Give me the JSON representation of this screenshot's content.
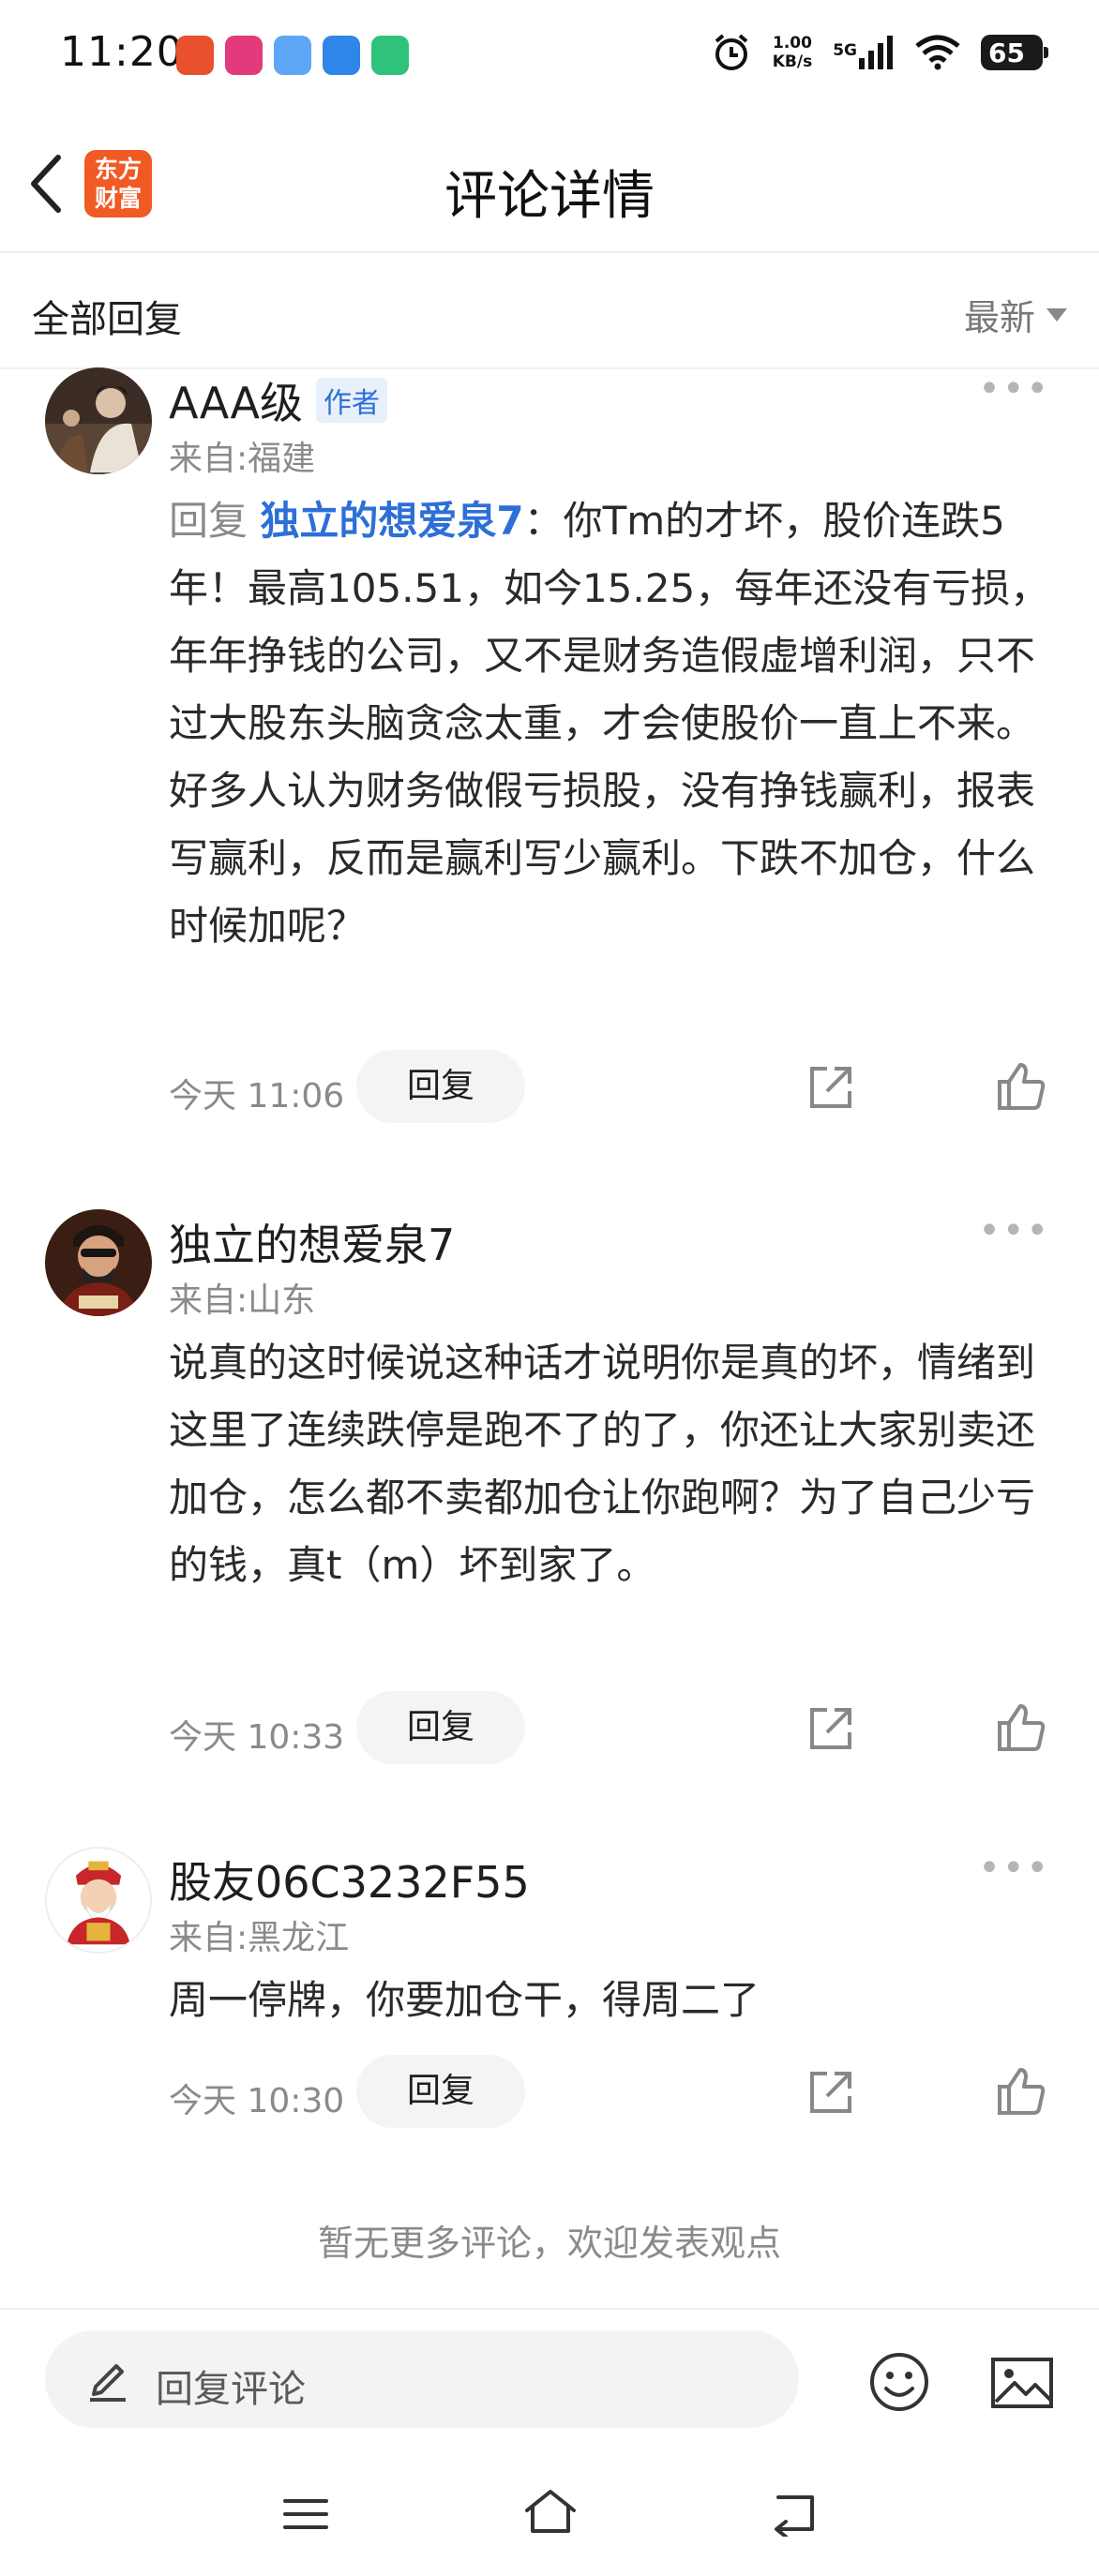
{
  "status_bar": {
    "time": "11:20",
    "speed_value": "1.00",
    "speed_unit": "KB/s",
    "network": "5G",
    "battery": "65"
  },
  "nav": {
    "title": "评论详情",
    "logo_line1": "东方",
    "logo_line2": "财富"
  },
  "filter": {
    "left_label": "全部回复",
    "sort_label": "最新"
  },
  "comments": [
    {
      "name": "AAA级",
      "badge": "作者",
      "from": "来自:福建",
      "reply_prefix": "回复",
      "reply_target": "独立的想爱泉7",
      "body": "：你Tm的才坏，股价连跌5年！最高105.51，如今15.25，每年还没有亏损，年年挣钱的公司，又不是财务造假虚增利润，只不过大股东头脑贪念太重，才会使股价一直上不来。好多人认为财务做假亏损股，没有挣钱赢利，报表写赢利，反而是赢利写少赢利。下跌不加仓，什么时候加呢？",
      "time": "今天 11:06",
      "reply_button": "回复",
      "more": "•••"
    },
    {
      "name": "独立的想爱泉7",
      "from": "来自:山东",
      "body": "说真的这时候说这种话才说明你是真的坏，情绪到这里了连续跌停是跑不了的了，你还让大家别卖还加仓，怎么都不卖都加仓让你跑啊？为了自己少亏的钱，真t（m）坏到家了。",
      "time": "今天 10:33",
      "reply_button": "回复",
      "more": "•••"
    },
    {
      "name": "股友06C3232F55",
      "from": "来自:黑龙江",
      "body": "周一停牌，你要加仓干，得周二了",
      "time": "今天 10:30",
      "reply_button": "回复",
      "more": "•••"
    }
  ],
  "no_more_text": "暂无更多评论，欢迎发表观点",
  "input": {
    "placeholder": "回复评论"
  },
  "colors": {
    "brand": "#f05a24",
    "link": "#2d6fd6",
    "muted": "#8a8a8a"
  }
}
